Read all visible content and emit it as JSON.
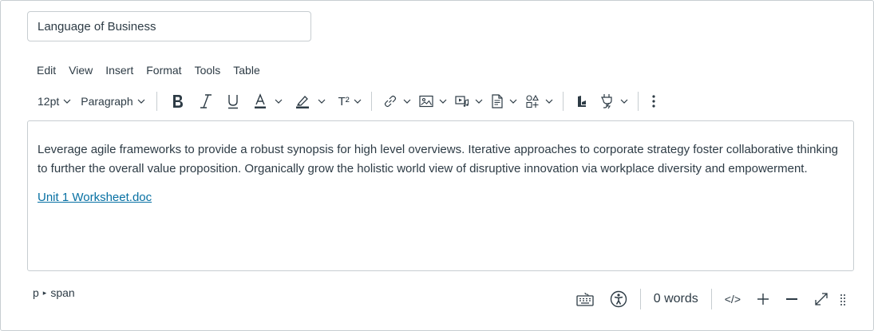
{
  "title_field": {
    "value": "Language of Business"
  },
  "menubar": {
    "items": [
      "Edit",
      "View",
      "Insert",
      "Format",
      "Tools",
      "Table"
    ]
  },
  "toolbar": {
    "font_size": "12pt",
    "block_format": "Paragraph",
    "superscript_label": "T²"
  },
  "content": {
    "paragraph": "Leverage agile frameworks to provide a robust synopsis for high level overviews. Iterative approaches to corporate strategy foster collaborative thinking to further the overall value proposition. Organically grow the holistic world view of disruptive innovation via workplace diversity and empowerment.",
    "link_text": "Unit 1 Worksheet.doc"
  },
  "statusbar": {
    "path_p": "p",
    "path_span": "span",
    "word_count": "0 words",
    "source_label": "</>"
  },
  "colors": {
    "link": "#0770a3",
    "text": "#2d3b45",
    "border": "#c7cdd1"
  }
}
